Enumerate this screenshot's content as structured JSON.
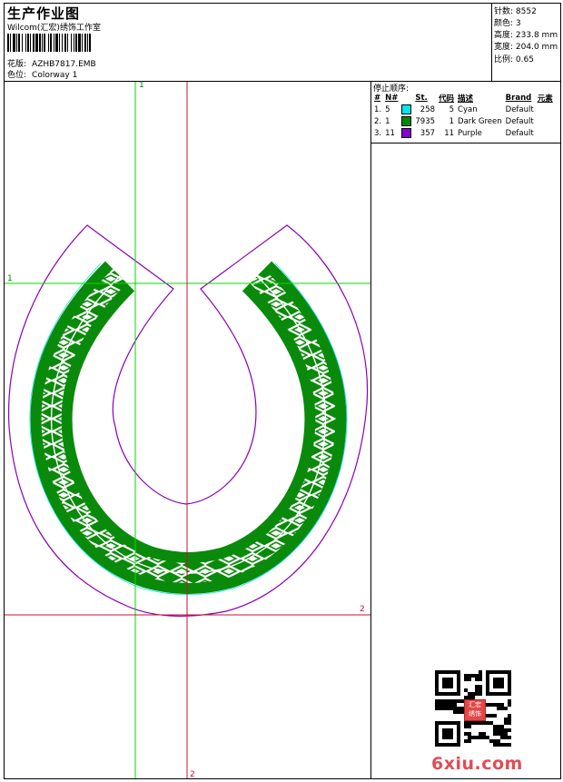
{
  "header": {
    "title": "生产作业图",
    "company": "Wilcom(汇宏)绣饰工作室",
    "design_label": "花版:",
    "design_value": "AZHB7817.EMB",
    "colorway_label": "色位:",
    "colorway_value": "Colorway 1"
  },
  "stats": {
    "stitches_label": "针数:",
    "stitches_value": "8552",
    "colors_label": "颜色:",
    "colors_value": "3",
    "height_label": "高度:",
    "height_value": "233.8 mm",
    "width_label": "宽度:",
    "width_value": "204.0 mm",
    "scale_label": "比例:",
    "scale_value": "0.65"
  },
  "stop_sequence": {
    "heading": "停止顺序:",
    "columns": [
      "#",
      "N#",
      "St.",
      "代码",
      "描述",
      "Brand",
      "元素"
    ],
    "rows": [
      {
        "index": "1.",
        "n": "5",
        "color": "#00e5ee",
        "st": "258",
        "code": "5",
        "desc": "Cyan",
        "brand": "Default"
      },
      {
        "index": "2.",
        "n": "1",
        "color": "#008800",
        "st": "7935",
        "code": "1",
        "desc": "Dark Green",
        "brand": "Default"
      },
      {
        "index": "3.",
        "n": "11",
        "color": "#8800cc",
        "st": "357",
        "code": "11",
        "desc": "Purple",
        "brand": "Default"
      }
    ]
  },
  "guides": {
    "green_top": "1",
    "green_left": "1",
    "red_right": "2",
    "red_bottom": "2"
  },
  "colors": {
    "guide_green": "#00dd00",
    "guide_red": "#c8102e",
    "outline_purple": "#8a00b8",
    "fill_green": "#0a8a0a",
    "edge_cyan": "#00e5ee"
  },
  "watermark": {
    "text": "6xiu.com",
    "seal_text": "汇宏\n绣饰"
  }
}
